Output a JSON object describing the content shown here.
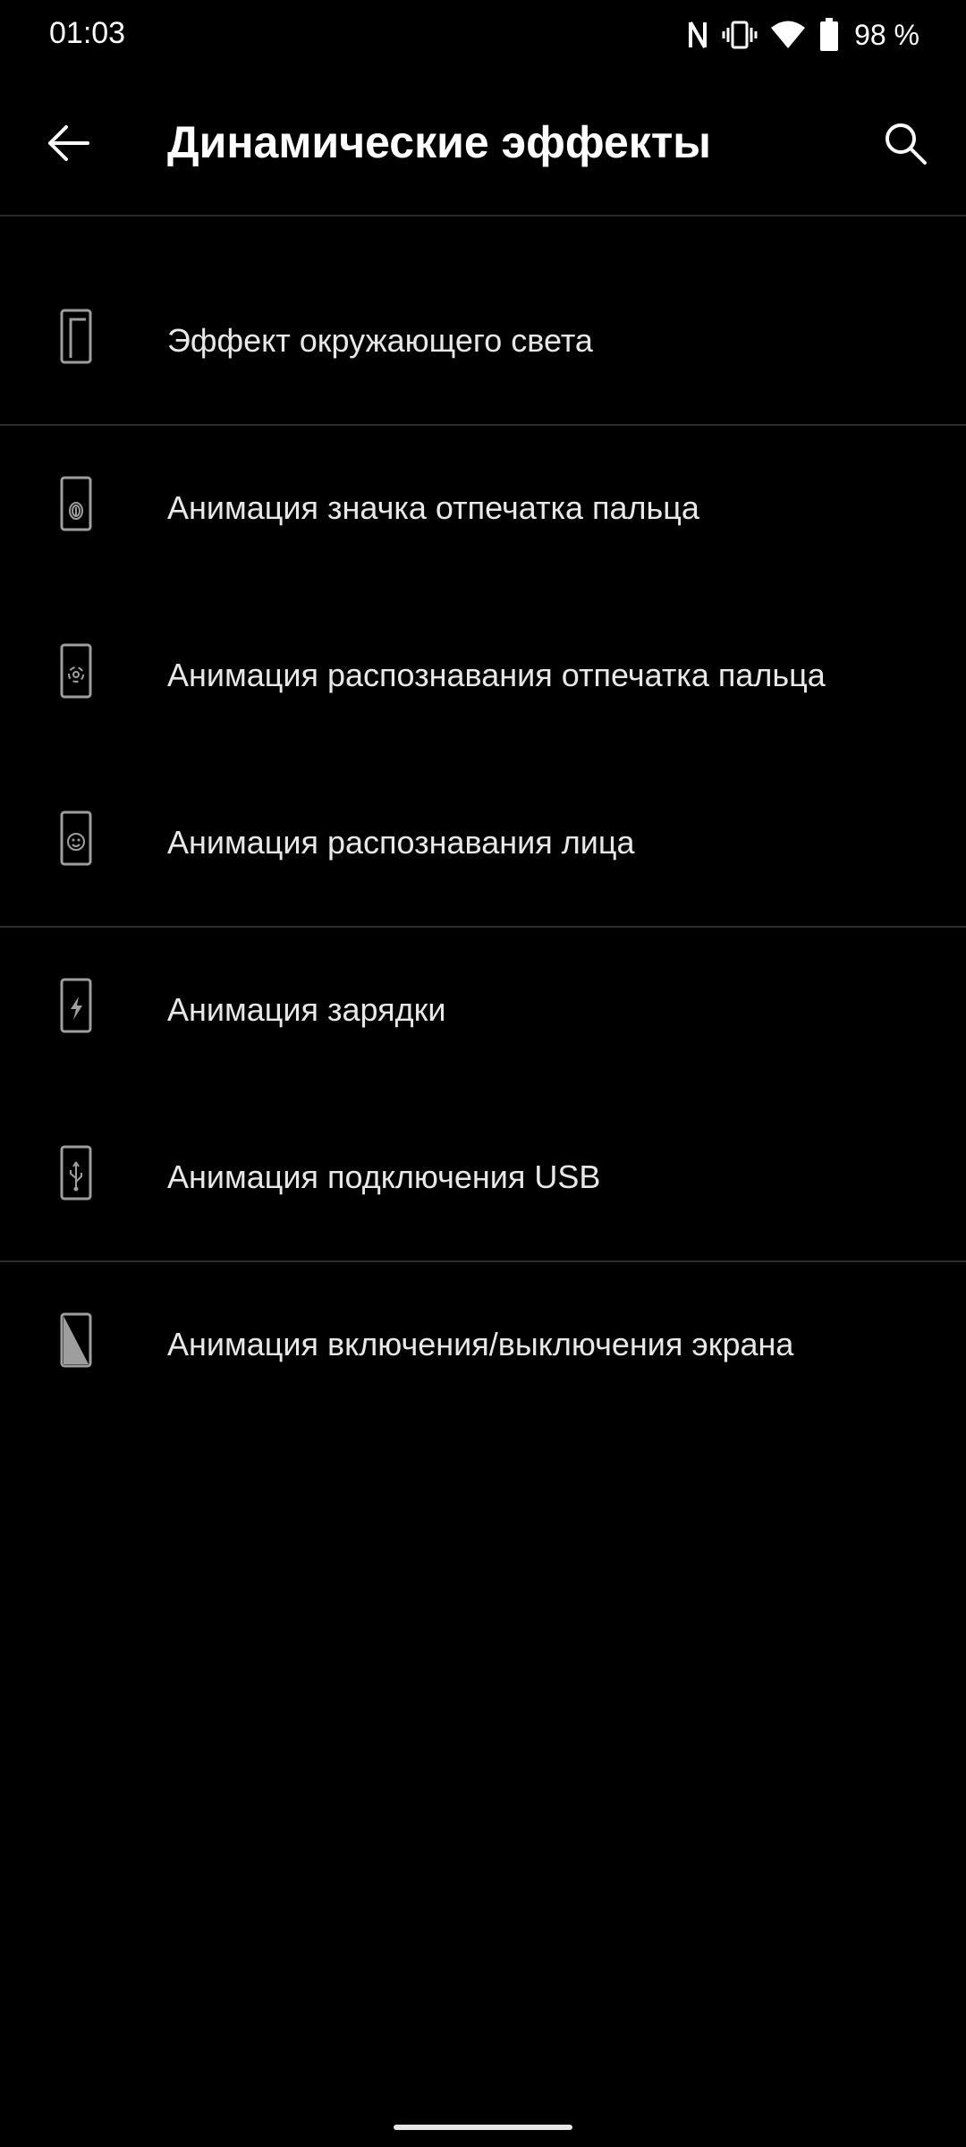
{
  "status_bar": {
    "time": "01:03",
    "icons": [
      "nfc-icon",
      "vibrate-icon",
      "wifi-icon",
      "battery-icon"
    ],
    "battery_percent": "98 %"
  },
  "app_bar": {
    "title": "Динамические эффекты",
    "back_icon": "arrow-left-icon",
    "search_icon": "search-icon"
  },
  "items": [
    {
      "label": "Эффект окружающего света",
      "icon": "ambient-light-icon"
    },
    {
      "label": "Анимация значка отпечатка пальца",
      "icon": "fingerprint-icon"
    },
    {
      "label": "Анимация распознавания отпечатка пальца",
      "icon": "fingerprint-scan-icon"
    },
    {
      "label": "Анимация распознавания лица",
      "icon": "face-icon"
    },
    {
      "label": "Анимация зарядки",
      "icon": "charging-icon"
    },
    {
      "label": "Анимация подключения USB",
      "icon": "usb-icon"
    },
    {
      "label": "Анимация включения/выключения экрана",
      "icon": "screen-on-off-icon"
    }
  ],
  "colors": {
    "background": "#000000",
    "text": "#e8e8e8",
    "icon": "#9e9e9e",
    "divider": "#2a2a2a"
  }
}
